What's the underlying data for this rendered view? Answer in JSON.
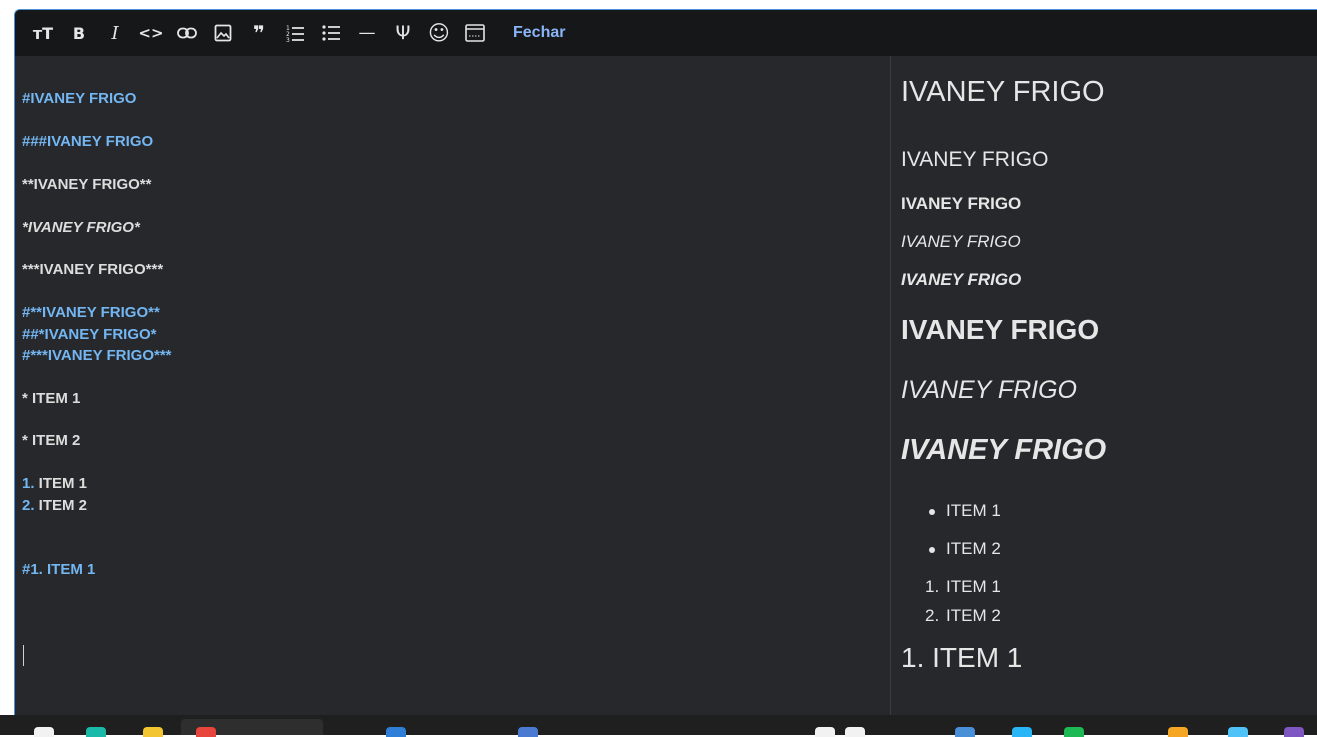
{
  "toolbar": {
    "buttons": [
      {
        "name": "heading-icon",
        "glyph": "тT"
      },
      {
        "name": "bold-icon",
        "glyph": "B"
      },
      {
        "name": "italic-icon",
        "glyph": "I"
      },
      {
        "name": "code-icon",
        "glyph": "<>"
      },
      {
        "name": "link-icon",
        "glyph": ""
      },
      {
        "name": "image-icon",
        "glyph": ""
      },
      {
        "name": "quote-icon",
        "glyph": "❞"
      },
      {
        "name": "ordered-list-icon",
        "glyph": ""
      },
      {
        "name": "unordered-list-icon",
        "glyph": ""
      },
      {
        "name": "horizontal-rule-icon",
        "glyph": "—"
      },
      {
        "name": "psi-icon",
        "glyph": "Ψ"
      },
      {
        "name": "emoji-icon",
        "glyph": "☺"
      },
      {
        "name": "preview-toggle-icon",
        "glyph": ""
      }
    ],
    "close_label": "Fechar"
  },
  "editor": {
    "lines": [
      "#IVANEY FRIGO",
      "###IVANEY FRIGO",
      "**IVANEY FRIGO**",
      "*IVANEY FRIGO*",
      "***IVANEY FRIGO***",
      "#**IVANEY FRIGO**",
      "##*IVANEY FRIGO*",
      "#***IVANEY FRIGO***",
      "* ITEM 1",
      "* ITEM 2",
      "1.",
      " ITEM 1",
      "2.",
      " ITEM 2",
      "#1. ITEM 1"
    ]
  },
  "preview": {
    "h1": "IVANEY FRIGO",
    "h3": "IVANEY FRIGO",
    "bold": "IVANEY FRIGO",
    "italic": "IVANEY FRIGO",
    "bold_italic": "IVANEY FRIGO",
    "h1_bold": "IVANEY FRIGO",
    "h2_italic": "IVANEY FRIGO",
    "h1_bold_italic": "IVANEY FRIGO",
    "bullets": [
      "ITEM 1",
      "ITEM 2"
    ],
    "ordered": [
      {
        "num": "1.",
        "label": "ITEM 1"
      },
      {
        "num": "2.",
        "label": "ITEM 2"
      }
    ],
    "h1_numbered": "1. ITEM 1"
  },
  "colors": {
    "accent": "#74b6f2",
    "background": "#26282b",
    "toolbar": "#161719",
    "text": "#e6e6e6"
  }
}
